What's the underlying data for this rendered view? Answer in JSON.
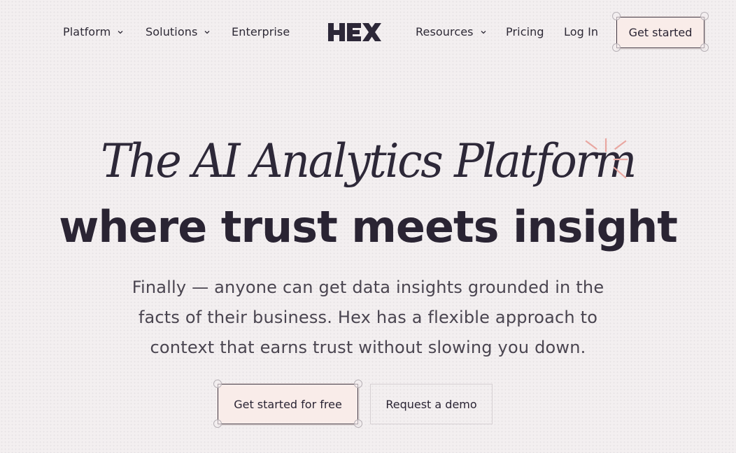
{
  "nav": {
    "items": [
      {
        "label": "Platform",
        "has_dropdown": true
      },
      {
        "label": "Solutions",
        "has_dropdown": true
      },
      {
        "label": "Enterprise",
        "has_dropdown": false
      },
      {
        "label": "Resources",
        "has_dropdown": true
      },
      {
        "label": "Pricing",
        "has_dropdown": false
      },
      {
        "label": "Log In",
        "has_dropdown": false
      }
    ],
    "logo_text": "HEX",
    "cta_label": "Get started"
  },
  "hero": {
    "headline_italic": "The AI Analytics Platform",
    "headline_bold": "where trust meets insight",
    "subtext_lines": [
      "Finally — anyone can get data insights grounded in the",
      "facts of their business. Hex has a flexible approach to",
      "context that earns trust without slowing you down."
    ],
    "primary_cta": "Get started for free",
    "secondary_cta": "Request a demo"
  },
  "colors": {
    "background": "#f3eff0",
    "text_dark": "#2a2433",
    "button_fill": "#f9ece9",
    "accent_sparkle": "#e9a7a1"
  },
  "icons": [
    "chevron-down-icon",
    "hex-logo",
    "sparkle-icon"
  ]
}
